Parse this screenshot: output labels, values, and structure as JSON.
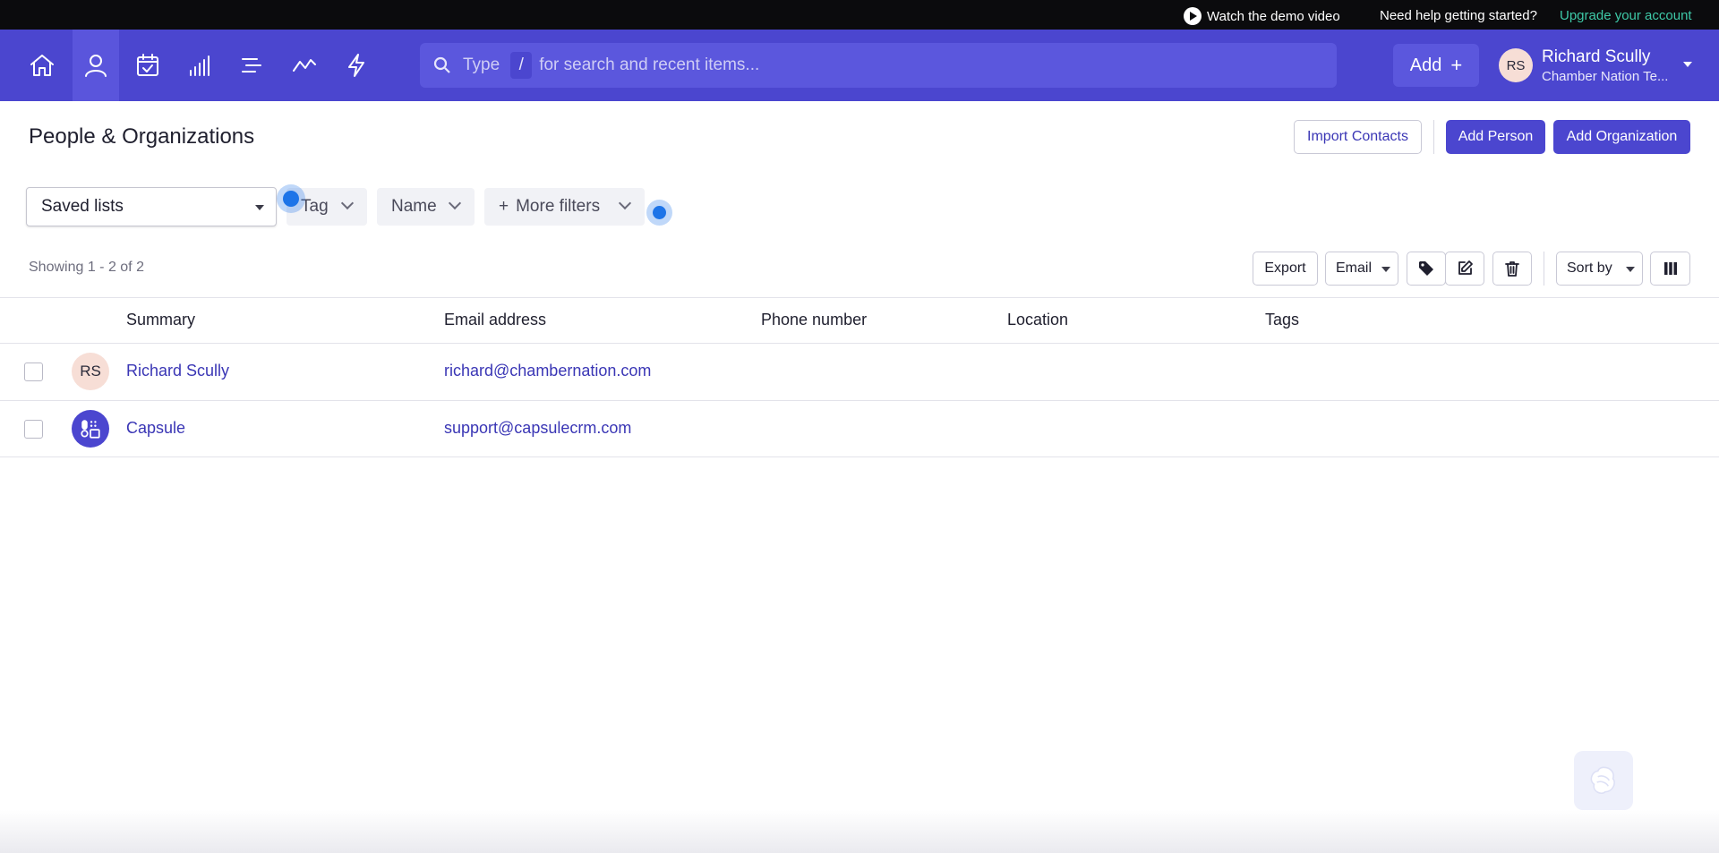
{
  "topbar": {
    "demo_label": "Watch the demo video",
    "help_label": "Need help getting started?",
    "upgrade_label": "Upgrade your account"
  },
  "nav": {
    "icons": [
      "home-icon",
      "person-icon",
      "calendar-check-icon",
      "bar-chart-icon",
      "list-icon",
      "trend-line-icon",
      "lightning-icon"
    ],
    "active": "person-icon"
  },
  "search": {
    "prefix": "Type",
    "shortcut": "/",
    "suffix": "for search and recent items..."
  },
  "header_actions": {
    "add_label": "Add",
    "add_symbol": "+"
  },
  "user": {
    "initials": "RS",
    "name": "Richard Scully",
    "org": "Chamber Nation Te..."
  },
  "page": {
    "title": "People & Organizations",
    "import_label": "Import Contacts",
    "add_person_label": "Add Person",
    "add_org_label": "Add Organization"
  },
  "filters": {
    "saved_lists": "Saved lists",
    "tag": "Tag",
    "name": "Name",
    "more_symbol": "+",
    "more": "More filters"
  },
  "toolbar": {
    "showing": "Showing 1 - 2 of 2",
    "export": "Export",
    "email": "Email",
    "sort_by": "Sort by"
  },
  "table": {
    "columns": [
      "Summary",
      "Email address",
      "Phone number",
      "Location",
      "Tags"
    ],
    "rows": [
      {
        "initials": "RS",
        "name": "Richard Scully",
        "email": "richard@chambernation.com",
        "phone": "",
        "location": "",
        "tags": ""
      },
      {
        "initials": "",
        "name": "Capsule",
        "email": "support@capsulecrm.com",
        "phone": "",
        "location": "",
        "tags": ""
      }
    ]
  },
  "colors": {
    "nav_bg": "#4b46cf",
    "accent": "#4b46cf",
    "link": "#3a36b5",
    "upgrade": "#3ec9a7",
    "avatar_person": "#f7ded6",
    "avatar_org": "#4b46cf"
  }
}
